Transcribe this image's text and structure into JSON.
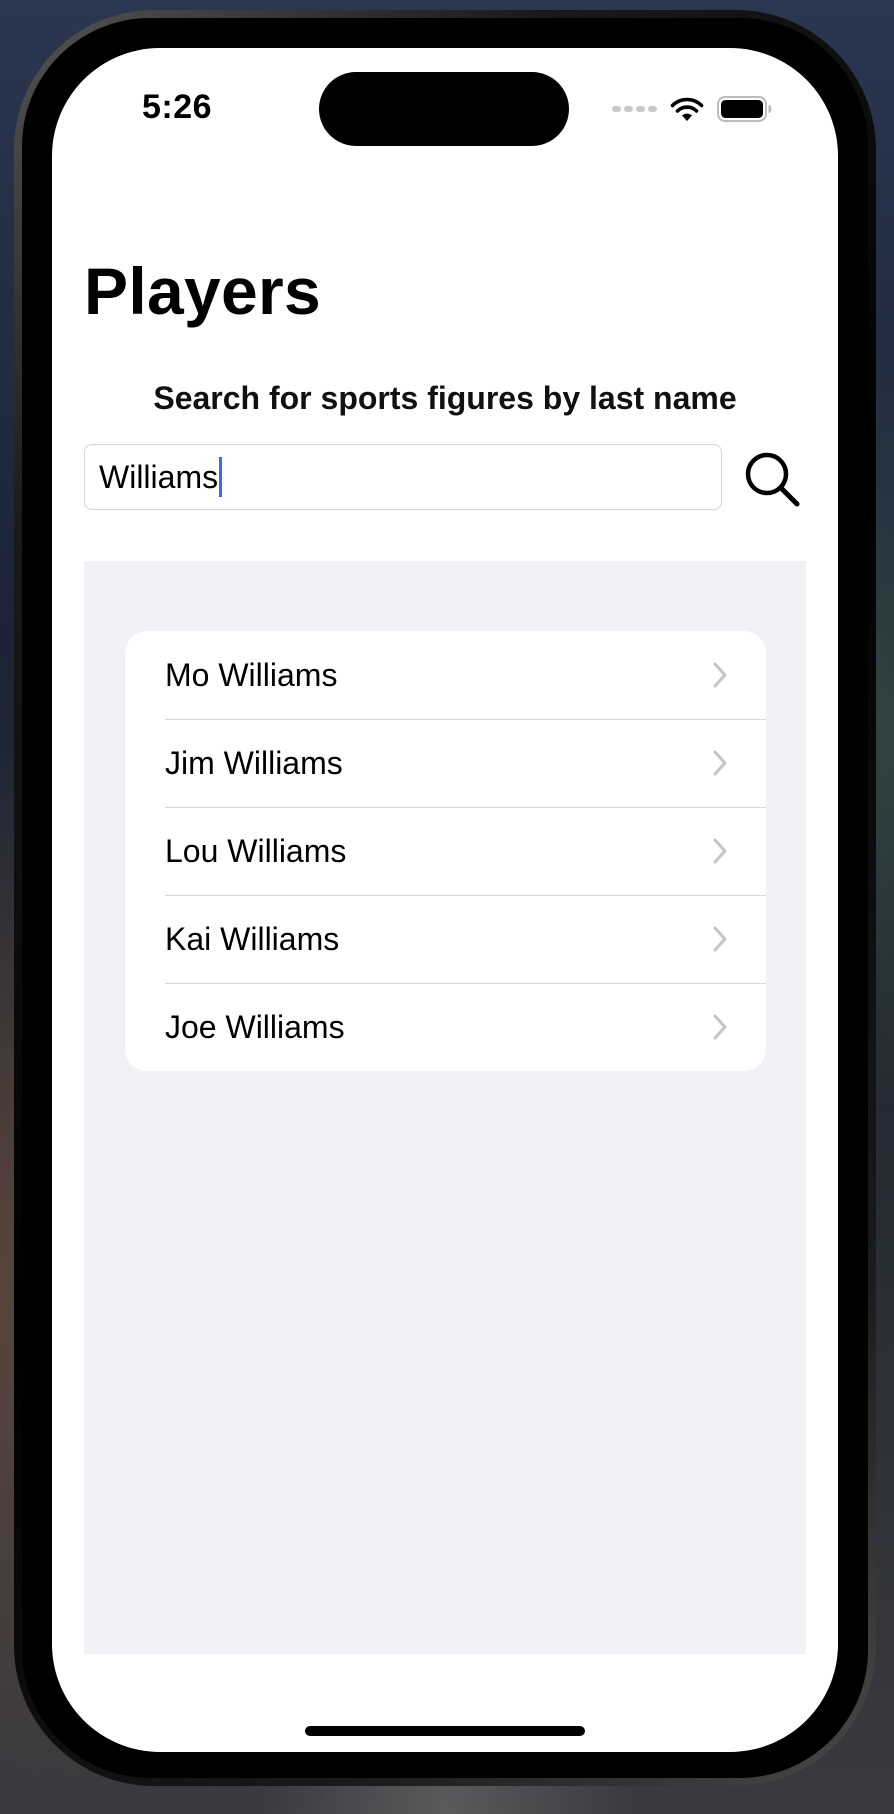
{
  "status_bar": {
    "time": "5:26"
  },
  "page": {
    "title": "Players",
    "subtitle": "Search for sports figures by last name"
  },
  "search": {
    "value": "Williams",
    "icon": "search-icon"
  },
  "players": [
    {
      "label": "Mo Williams"
    },
    {
      "label": "Jim Williams"
    },
    {
      "label": "Lou Williams"
    },
    {
      "label": "Kai Williams"
    },
    {
      "label": "Joe Williams"
    }
  ],
  "colors": {
    "caret": "#3a6fe0",
    "list_background": "#f1f1f6",
    "chevron": "#c4c4c7"
  }
}
